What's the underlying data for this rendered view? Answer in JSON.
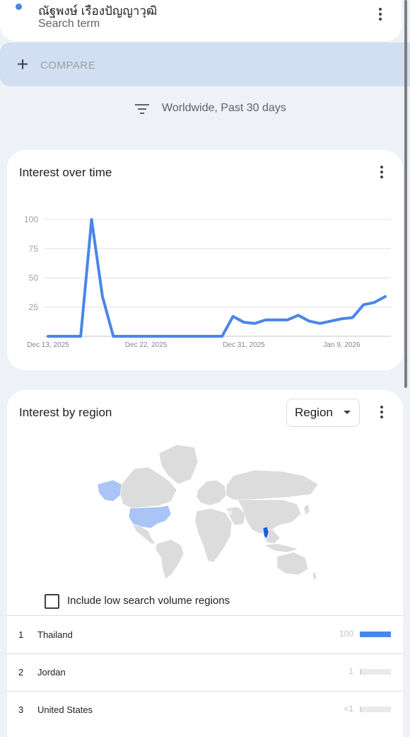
{
  "search_term": {
    "name": "ณัฐพงษ์ เรืองปัญญาวุฒิ",
    "subtitle": "Search term",
    "color": "#4a86e8"
  },
  "compare": {
    "label": "COMPARE",
    "icon": "plus-icon"
  },
  "filters": {
    "label": "Worldwide, Past 30 days",
    "icon": "filter-icon"
  },
  "interest_over_time": {
    "title": "Interest over time",
    "menu_icon": "more-vert-icon"
  },
  "chart_data": {
    "type": "line",
    "title": "Interest over time",
    "ylim": [
      0,
      100
    ],
    "y_ticks": [
      "100",
      "75",
      "50",
      "25"
    ],
    "x_tick_labels": [
      "Dec 13, 2025",
      "Dec 22, 2025",
      "Dec 31, 2025",
      "Jan 9, 2026"
    ],
    "x": [
      "Dec 13",
      "Dec 14",
      "Dec 15",
      "Dec 16",
      "Dec 17",
      "Dec 18",
      "Dec 19",
      "Dec 20",
      "Dec 21",
      "Dec 22",
      "Dec 23",
      "Dec 24",
      "Dec 25",
      "Dec 26",
      "Dec 27",
      "Dec 28",
      "Dec 29",
      "Dec 30",
      "Dec 31",
      "Jan 1",
      "Jan 2",
      "Jan 3",
      "Jan 4",
      "Jan 5",
      "Jan 6",
      "Jan 7",
      "Jan 8",
      "Jan 9",
      "Jan 10",
      "Jan 11",
      "Jan 12",
      "Jan 13"
    ],
    "series": [
      {
        "values": [
          0,
          0,
          0,
          0,
          100,
          34,
          0,
          0,
          0,
          0,
          0,
          0,
          0,
          0,
          0,
          0,
          0,
          17,
          12,
          11,
          14,
          14,
          14,
          18,
          13,
          11,
          13,
          15,
          16,
          27,
          29,
          34
        ],
        "color": "#4a86e8"
      }
    ],
    "grid": true
  },
  "interest_by_region": {
    "title": "Interest by region",
    "select_value": "Region",
    "menu_icon": "more-vert-icon",
    "low_volume_label": "Include low search volume regions",
    "rows": [
      {
        "rank": "1",
        "name": "Thailand",
        "value_text": "100",
        "value": 100
      },
      {
        "rank": "2",
        "name": "Jordan",
        "value_text": "1",
        "value": 1
      },
      {
        "rank": "3",
        "name": "United States",
        "value_text": "<1",
        "value": 0.5
      }
    ]
  }
}
